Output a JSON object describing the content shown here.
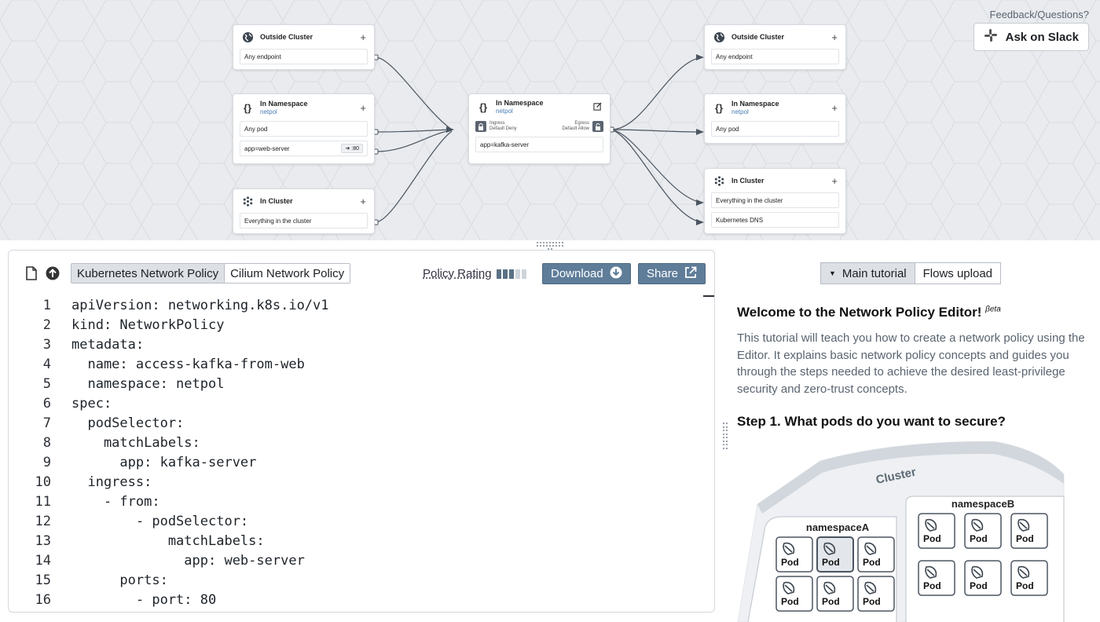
{
  "feedback": {
    "label": "Feedback/Questions?",
    "slack_button": "Ask on Slack"
  },
  "graph": {
    "left_cards": [
      {
        "title": "Outside Cluster",
        "icon": "globe-icon",
        "rows": [
          {
            "label": "Any endpoint"
          }
        ]
      },
      {
        "title": "In Namespace",
        "subtitle": "netpol",
        "icon": "braces-icon",
        "rows": [
          {
            "label": "Any pod"
          },
          {
            "label": "app=web-server",
            "port": "➔ :80"
          }
        ]
      },
      {
        "title": "In Cluster",
        "icon": "cluster-icon",
        "rows": [
          {
            "label": "Everything in the cluster"
          }
        ]
      }
    ],
    "center_card": {
      "title": "In Namespace",
      "subtitle": "netpol",
      "ingress_label": "Ingress",
      "ingress_policy": "Default Deny",
      "egress_label": "Egress",
      "egress_policy": "Default Allow",
      "selector": "app=kafka-server"
    },
    "right_cards": [
      {
        "title": "Outside Cluster",
        "icon": "globe-icon",
        "rows": [
          {
            "label": "Any endpoint"
          }
        ]
      },
      {
        "title": "In Namespace",
        "subtitle": "netpol",
        "icon": "braces-icon",
        "rows": [
          {
            "label": "Any pod"
          }
        ]
      },
      {
        "title": "In Cluster",
        "icon": "cluster-icon",
        "rows": [
          {
            "label": "Everything in the cluster"
          },
          {
            "label": "Kubernetes DNS"
          }
        ]
      }
    ]
  },
  "editor": {
    "tabs": [
      "Kubernetes Network Policy",
      "Cilium Network Policy"
    ],
    "active_tab": 0,
    "policy_rating_label": "Policy Rating",
    "policy_rating_level": 3,
    "policy_rating_max": 5,
    "download_label": "Download",
    "share_label": "Share",
    "code_lines": [
      "apiVersion: networking.k8s.io/v1",
      "kind: NetworkPolicy",
      "metadata:",
      "  name: access-kafka-from-web",
      "  namespace: netpol",
      "spec:",
      "  podSelector:",
      "    matchLabels:",
      "      app: kafka-server",
      "  ingress:",
      "    - from:",
      "        - podSelector:",
      "            matchLabels:",
      "              app: web-server",
      "      ports:",
      "        - port: 80"
    ]
  },
  "tutorial": {
    "tabs": [
      "Main tutorial",
      "Flows upload"
    ],
    "heading": "Welcome to the Network Policy Editor!",
    "heading_badge": "βeta",
    "intro": "This tutorial will teach you how to create a network policy using the Editor. It explains basic network policy concepts and guides you through the steps needed to achieve the desired least-privilege security and zero-trust concepts.",
    "step1": "Step 1. What pods do you want to secure?",
    "diagram": {
      "cluster_label": "Cluster",
      "namespaceA": "namespaceA",
      "namespaceB": "namespaceB",
      "pod_label": "Pod"
    }
  }
}
